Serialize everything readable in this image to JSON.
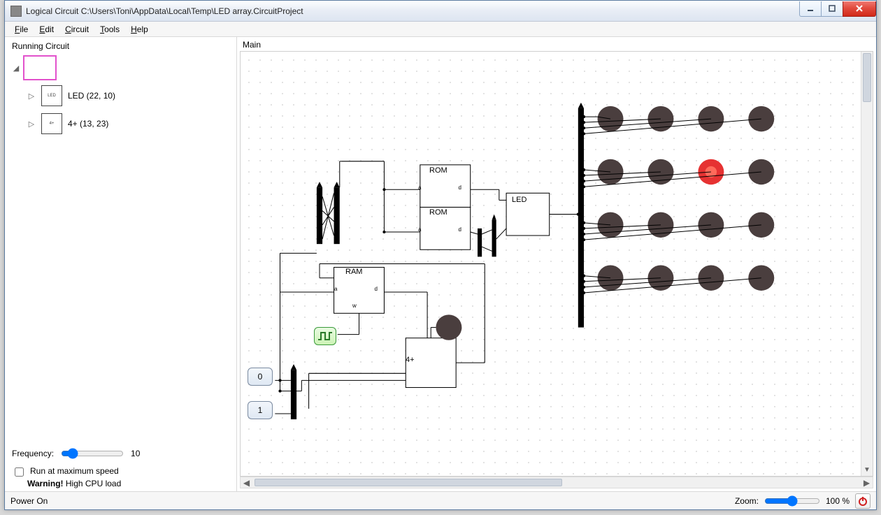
{
  "window": {
    "title": "Logical Circuit C:\\Users\\Toni\\AppData\\Local\\Temp\\LED array.CircuitProject"
  },
  "menu": {
    "file": "File",
    "edit": "Edit",
    "circuit": "Circuit",
    "tools": "Tools",
    "help": "Help"
  },
  "sidebar": {
    "title": "Running Circuit",
    "items": [
      {
        "label": ""
      },
      {
        "label": "LED  (22, 10)"
      },
      {
        "label": "4+  (13, 23)"
      }
    ],
    "frequency_label": "Frequency:",
    "frequency_value": "10",
    "run_max_label": "Run at maximum speed",
    "warning_bold": "Warning!",
    "warning_rest": " High CPU load"
  },
  "main": {
    "title": "Main"
  },
  "circuit": {
    "rom1": "ROM",
    "rom2": "ROM",
    "ram": "RAM",
    "led": "LED",
    "fourplus": "4+",
    "pin_a": "a",
    "pin_d": "d",
    "pin_w": "w",
    "input0": "0",
    "input1": "1"
  },
  "status": {
    "power": "Power On",
    "zoom_label": "Zoom:",
    "zoom_value": "100 %"
  }
}
